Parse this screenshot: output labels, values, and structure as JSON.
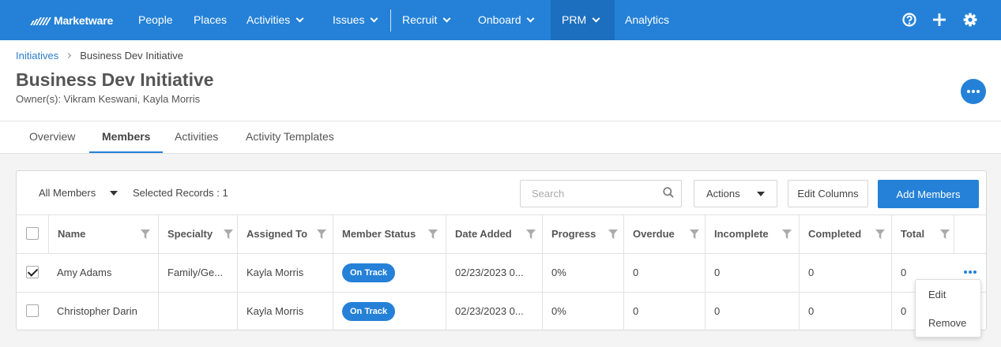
{
  "app": {
    "name": "Marketware"
  },
  "nav": {
    "items": [
      {
        "label": "People",
        "dropdown": false
      },
      {
        "label": "Places",
        "dropdown": false
      },
      {
        "label": "Activities",
        "dropdown": true
      },
      {
        "label": "Issues",
        "dropdown": true
      },
      {
        "label": "Recruit",
        "dropdown": true
      },
      {
        "label": "Onboard",
        "dropdown": true
      },
      {
        "label": "PRM",
        "dropdown": true,
        "active": true
      },
      {
        "label": "Analytics",
        "dropdown": false
      }
    ],
    "icons": [
      "help-icon",
      "plus-icon",
      "gear-icon"
    ]
  },
  "breadcrumb": {
    "parent": "Initiatives",
    "current": "Business Dev Initiative"
  },
  "page": {
    "title": "Business Dev Initiative",
    "owners": "Owner(s): Vikram Keswani, Kayla Morris"
  },
  "tabs": [
    {
      "label": "Overview"
    },
    {
      "label": "Members",
      "active": true
    },
    {
      "label": "Activities"
    },
    {
      "label": "Activity Templates"
    }
  ],
  "toolbar": {
    "filter": "All Members",
    "selected": "Selected Records : 1",
    "search_placeholder": "Search",
    "actions_label": "Actions",
    "edit_columns_label": "Edit Columns",
    "add_members_label": "Add Members"
  },
  "table": {
    "columns": [
      "Name",
      "Specialty",
      "Assigned To",
      "Member Status",
      "Date Added",
      "Progress",
      "Overdue",
      "Incomplete",
      "Completed",
      "Total"
    ],
    "rows": [
      {
        "checked": true,
        "name": "Amy Adams",
        "specialty": "Family/Ge...",
        "assigned_to": "Kayla Morris",
        "status": "On Track",
        "date_added": "02/23/2023 0...",
        "progress": "0%",
        "overdue": "0",
        "incomplete": "0",
        "completed": "0",
        "total": "0"
      },
      {
        "checked": false,
        "name": "Christopher Darin",
        "specialty": "",
        "assigned_to": "Kayla Morris",
        "status": "On Track",
        "date_added": "02/23/2023 0...",
        "progress": "0%",
        "overdue": "0",
        "incomplete": "0",
        "completed": "0",
        "total": "0"
      }
    ]
  },
  "row_menu": {
    "edit_label": "Edit",
    "remove_label": "Remove"
  },
  "colors": {
    "brand": "#2481d7",
    "nav_active": "#1c6fbe"
  }
}
